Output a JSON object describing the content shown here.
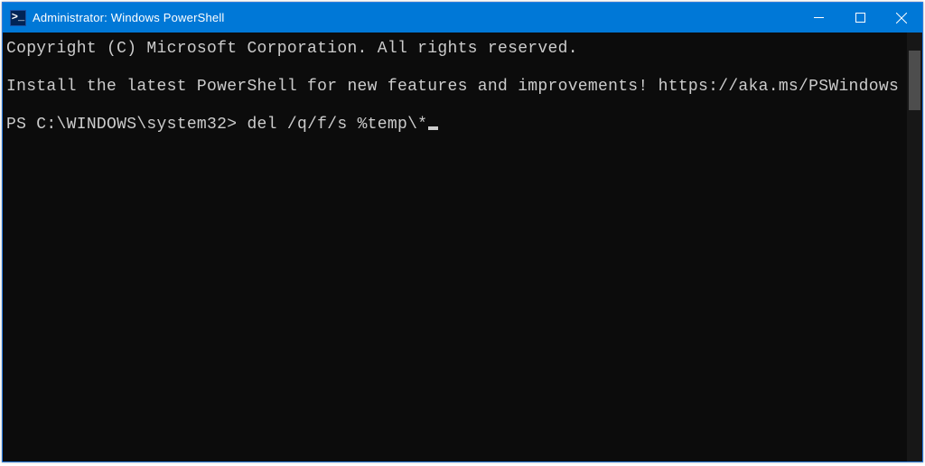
{
  "titlebar": {
    "icon_glyph": ">_",
    "title": "Administrator: Windows PowerShell"
  },
  "console": {
    "copyright_line": "Copyright (C) Microsoft Corporation. All rights reserved.",
    "install_line": "Install the latest PowerShell for new features and improvements! https://aka.ms/PSWindows",
    "prompt": "PS C:\\WINDOWS\\system32>",
    "command": "del /q/f/s %temp\\*"
  }
}
